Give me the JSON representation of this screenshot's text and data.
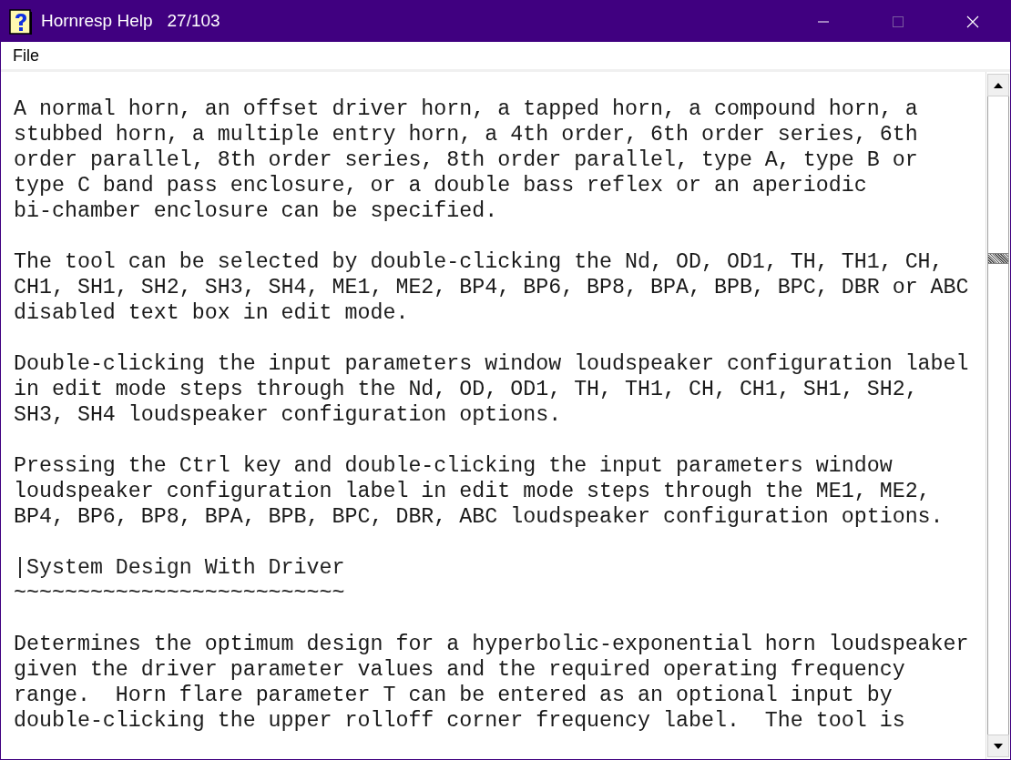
{
  "window": {
    "title": "Hornresp Help",
    "page": "27/103",
    "maximize_disabled": true
  },
  "menu": [
    {
      "label": "File"
    }
  ],
  "paragraphs": [
    {
      "kind": "text",
      "text": "A normal horn, an offset driver horn, a tapped horn, a compound horn, a\nstubbed horn, a multiple entry horn, a 4th order, 6th order series, 6th\norder parallel, 8th order series, 8th order parallel, type A, type B or\ntype C band pass enclosure, or a double bass reflex or an aperiodic\nbi-chamber enclosure can be specified."
    },
    {
      "kind": "text",
      "text": "The tool can be selected by double-clicking the Nd, OD, OD1, TH, TH1, CH,\nCH1, SH1, SH2, SH3, SH4, ME1, ME2, BP4, BP6, BP8, BPA, BPB, BPC, DBR or ABC\ndisabled text box in edit mode."
    },
    {
      "kind": "text",
      "text": "Double-clicking the input parameters window loudspeaker configuration label\nin edit mode steps through the Nd, OD, OD1, TH, TH1, CH, CH1, SH1, SH2,\nSH3, SH4 loudspeaker configuration options."
    },
    {
      "kind": "text",
      "text": "Pressing the Ctrl key and double-clicking the input parameters window\nloudspeaker configuration label in edit mode steps through the ME1, ME2,\nBP4, BP6, BP8, BPA, BPB, BPC, DBR, ABC loudspeaker configuration options."
    },
    {
      "kind": "heading",
      "text": "|System Design With Driver\n~~~~~~~~~~~~~~~~~~~~~~~~~~"
    },
    {
      "kind": "text",
      "text": "Determines the optimum design for a hyperbolic-exponential horn loudspeaker\ngiven the driver parameter values and the required operating frequency\nrange.  Horn flare parameter T can be entered as an optional input by\ndouble-clicking the upper rolloff corner frequency label.  The tool is"
    }
  ]
}
